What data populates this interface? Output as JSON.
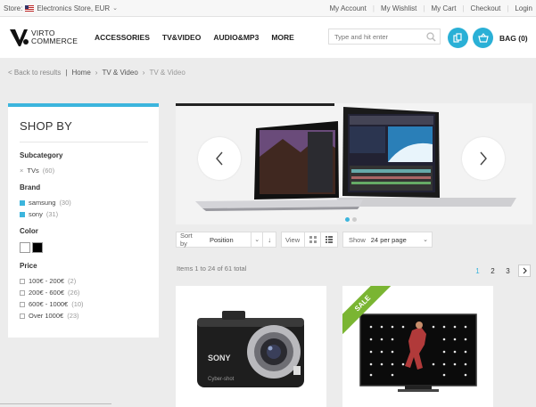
{
  "topbar": {
    "store_label": "Store:",
    "store_value": "Electronics Store, EUR",
    "links": [
      "My Account",
      "My Wishlist",
      "My Cart",
      "Checkout",
      "Login"
    ]
  },
  "header": {
    "logo_line1": "VIRTO",
    "logo_line2": "COMMERCE",
    "nav": [
      "ACCESSORIES",
      "TV&VIDEO",
      "AUDIO&MP3",
      "MORE"
    ],
    "search_placeholder": "Type and hit enter",
    "bag_label": "BAG (0)"
  },
  "breadcrumb": {
    "back": "< Back to results",
    "items": [
      "Home",
      "TV & Video",
      "TV & Video"
    ]
  },
  "sidebar": {
    "title": "SHOP BY",
    "subcategory_title": "Subcategory",
    "subcategory_items": [
      {
        "label": "TVs",
        "count": "(60)"
      }
    ],
    "brand_title": "Brand",
    "brand_items": [
      {
        "label": "samsung",
        "count": "(30)"
      },
      {
        "label": "sony",
        "count": "(31)"
      }
    ],
    "color_title": "Color",
    "colors": [
      "#ffffff",
      "#000000"
    ],
    "price_title": "Price",
    "price_items": [
      {
        "label": "100€ - 200€",
        "count": "(2)"
      },
      {
        "label": "200€ - 600€",
        "count": "(26)"
      },
      {
        "label": "600€ - 1000€",
        "count": "(10)"
      },
      {
        "label": "Over 1000€",
        "count": "(23)"
      }
    ]
  },
  "toolbar": {
    "sort_label": "Sort by",
    "sort_value": "Position",
    "view_label": "View",
    "show_label": "Show",
    "show_value": "24 per page"
  },
  "listing": {
    "items_total": "Items 1 to 24 of 61 total",
    "pages": [
      "1",
      "2",
      "3"
    ],
    "active_page": "1"
  },
  "products": [
    {
      "brand_text": "SONY",
      "model_text": "Cyber-shot"
    },
    {
      "badge": "SALE"
    }
  ],
  "colors": {
    "accent": "#3cb5dd",
    "sale": "#7ab532"
  }
}
